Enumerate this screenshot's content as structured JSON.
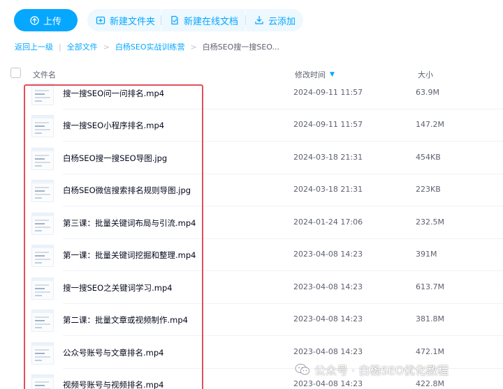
{
  "toolbar": {
    "upload_label": "上传",
    "new_folder_label": "新建文件夹",
    "new_doc_label": "新建在线文档",
    "cloud_add_label": "云添加"
  },
  "breadcrumb": {
    "back": "返回上一级",
    "all_files": "全部文件",
    "parent": "白杨SEO实战训练营",
    "current": "白杨SEO搜一搜SEO..."
  },
  "table": {
    "col_name": "文件名",
    "col_time": "修改时间",
    "col_size": "大小",
    "rows": [
      {
        "name": "搜一搜SEO问一问排名.mp4",
        "time": "2024-09-11 11:57",
        "size": "63.9M"
      },
      {
        "name": "搜一搜SEO小程序排名.mp4",
        "time": "2024-09-11 11:57",
        "size": "147.2M"
      },
      {
        "name": "白杨SEO搜一搜SEO导图.jpg",
        "time": "2024-03-18 21:31",
        "size": "454KB"
      },
      {
        "name": "白杨SEO微信搜索排名规则导图.jpg",
        "time": "2024-03-18 21:31",
        "size": "223KB"
      },
      {
        "name": "第三课：批量关键词布局与引流.mp4",
        "time": "2024-01-24 17:06",
        "size": "232.5M"
      },
      {
        "name": "第一课：批量关键词挖掘和整理.mp4",
        "time": "2023-04-08 14:23",
        "size": "391M"
      },
      {
        "name": "搜一搜SEO之关键词学习.mp4",
        "time": "2023-04-08 14:23",
        "size": "613.7M"
      },
      {
        "name": "第二课：批量文章或视频制作.mp4",
        "time": "2023-04-08 14:23",
        "size": "381.8M"
      },
      {
        "name": "公众号账号与文章排名.mp4",
        "time": "2023-04-08 14:23",
        "size": "472.1M"
      },
      {
        "name": "视频号账号与视频排名.mp4",
        "time": "2023-04-08 14:23",
        "size": "422.8M"
      }
    ]
  },
  "watermark": {
    "text": "公众号 · 白杨SEO优化教程"
  },
  "colors": {
    "accent": "#06a7ff",
    "highlight_border": "#e0505b"
  },
  "icons": {
    "upload": "upload-icon",
    "new_folder": "folder-plus-icon",
    "new_doc": "document-icon",
    "cloud_add": "download-icon",
    "sort": "sort-desc-icon",
    "wechat": "wechat-icon"
  }
}
